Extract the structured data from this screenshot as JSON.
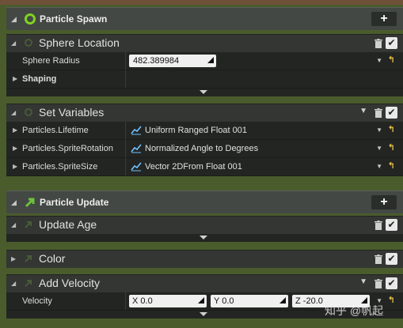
{
  "spawn": {
    "title": "Particle Spawn",
    "add_label": "+"
  },
  "sphere": {
    "title": "Sphere Location",
    "radius_label": "Sphere Radius",
    "radius_value": "482.389984",
    "shaping_label": "Shaping"
  },
  "setvars": {
    "title": "Set Variables",
    "rows": [
      {
        "label": "Particles.Lifetime",
        "value": "Uniform Ranged Float 001"
      },
      {
        "label": "Particles.SpriteRotation",
        "value": "Normalized Angle to Degrees"
      },
      {
        "label": "Particles.SpriteSize",
        "value": "Vector 2DFrom Float 001"
      }
    ]
  },
  "update": {
    "title": "Particle Update",
    "add_label": "+"
  },
  "update_age": {
    "title": "Update Age"
  },
  "color": {
    "title": "Color"
  },
  "velocity": {
    "title": "Add Velocity",
    "label": "Velocity",
    "x_label": "X",
    "x_value": "0.0",
    "y_label": "Y",
    "y_value": "0.0",
    "z_label": "Z",
    "z_value": "-20.0"
  },
  "watermark": "知乎 @帆起",
  "colors": {
    "spawn_icon": "#7ed321",
    "update_icon": "#6ac23a",
    "bg": "#4a5c2c",
    "reset": "#e5c04a"
  }
}
